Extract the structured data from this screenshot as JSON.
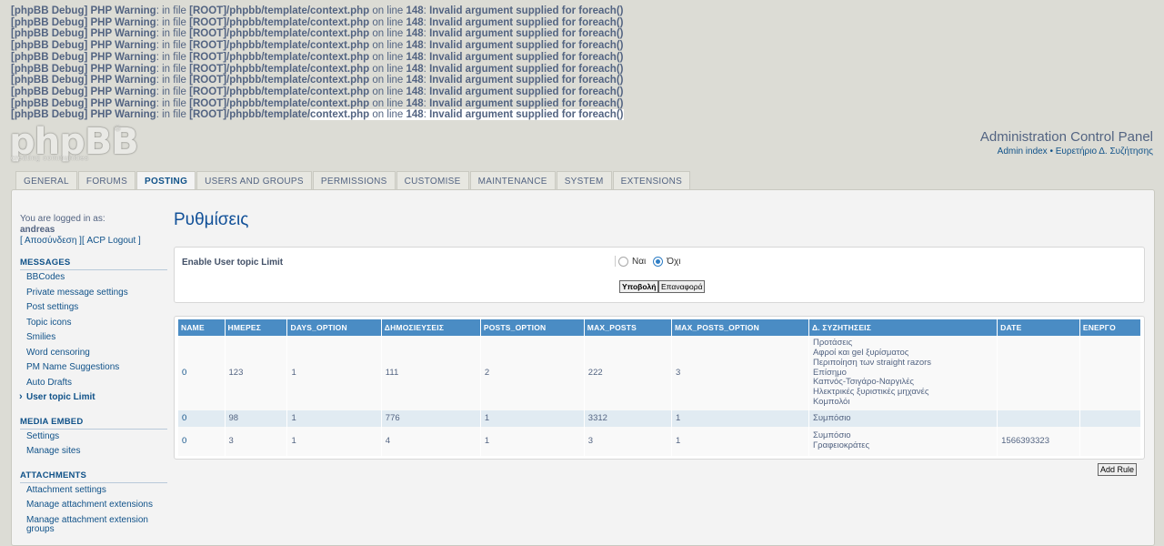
{
  "debug_lines": [
    {
      "prefix": "[phpBB Debug] PHP Warning",
      "t1": ": in file ",
      "file": "[ROOT]/phpbb/template/context.php",
      "t2": " on line ",
      "line": "148",
      "t3": ": ",
      "msg": "Invalid argument supplied for foreach()"
    },
    {
      "prefix": "[phpBB Debug] PHP Warning",
      "t1": ": in file ",
      "file": "[ROOT]/phpbb/template/context.php",
      "t2": " on line ",
      "line": "148",
      "t3": ": ",
      "msg": "Invalid argument supplied for foreach()"
    },
    {
      "prefix": "[phpBB Debug] PHP Warning",
      "t1": ": in file ",
      "file": "[ROOT]/phpbb/template/context.php",
      "t2": " on line ",
      "line": "148",
      "t3": ": ",
      "msg": "Invalid argument supplied for foreach()"
    },
    {
      "prefix": "[phpBB Debug] PHP Warning",
      "t1": ": in file ",
      "file": "[ROOT]/phpbb/template/context.php",
      "t2": " on line ",
      "line": "148",
      "t3": ": ",
      "msg": "Invalid argument supplied for foreach()"
    },
    {
      "prefix": "[phpBB Debug] PHP Warning",
      "t1": ": in file ",
      "file": "[ROOT]/phpbb/template/context.php",
      "t2": " on line ",
      "line": "148",
      "t3": ": ",
      "msg": "Invalid argument supplied for foreach()"
    },
    {
      "prefix": "[phpBB Debug] PHP Warning",
      "t1": ": in file ",
      "file": "[ROOT]/phpbb/template/context.php",
      "t2": " on line ",
      "line": "148",
      "t3": ": ",
      "msg": "Invalid argument supplied for foreach()"
    },
    {
      "prefix": "[phpBB Debug] PHP Warning",
      "t1": ": in file ",
      "file": "[ROOT]/phpbb/template/context.php",
      "t2": " on line ",
      "line": "148",
      "t3": ": ",
      "msg": "Invalid argument supplied for foreach()"
    },
    {
      "prefix": "[phpBB Debug] PHP Warning",
      "t1": ": in file ",
      "file": "[ROOT]/phpbb/template/context.php",
      "t2": " on line ",
      "line": "148",
      "t3": ": ",
      "msg": "Invalid argument supplied for foreach()"
    },
    {
      "prefix": "[phpBB Debug] PHP Warning",
      "t1": ": in file ",
      "file": "[ROOT]/phpbb/template/context.php",
      "t2": " on line ",
      "line": "148",
      "t3": ": ",
      "msg": "Invalid argument supplied for foreach()"
    },
    {
      "prefix": "[phpBB Debug] PHP Warning",
      "t1": ": in file ",
      "file": "[ROOT]/phpbb/template/",
      "file2": "context.php",
      "t2": " on line ",
      "line": "148",
      "t3": ": ",
      "msg": "Invalid argument supplied for foreach()"
    }
  ],
  "logo": {
    "text": "phpBB",
    "sub": "creating communities",
    "reg": "®"
  },
  "header": {
    "title": "Administration Control Panel",
    "link_admin": "Admin index",
    "sep": " • ",
    "link_board": "Ευρετήριο Δ. Συζήτησης"
  },
  "tabs": [
    "GENERAL",
    "FORUMS",
    "POSTING",
    "USERS AND GROUPS",
    "PERMISSIONS",
    "CUSTOMISE",
    "MAINTENANCE",
    "SYSTEM",
    "EXTENSIONS"
  ],
  "active_tab": "POSTING",
  "sidebar": {
    "logged_in_as": "You are logged in as:",
    "username": "andreas",
    "logout_links": "[ Αποσύνδεση ][ ACP Logout ]",
    "sections": [
      {
        "title": "MESSAGES",
        "items": [
          "BBCodes",
          "Private message settings",
          "Post settings",
          "Topic icons",
          "Smilies",
          "Word censoring",
          "PM Name Suggestions",
          "Auto Drafts",
          "User topic Limit"
        ]
      },
      {
        "title": "MEDIA EMBED",
        "items": [
          "Settings",
          "Manage sites"
        ]
      },
      {
        "title": "ATTACHMENTS",
        "items": [
          "Attachment settings",
          "Manage attachment extensions",
          "Manage attachment extension groups"
        ]
      }
    ],
    "active_item": "User topic Limit"
  },
  "main": {
    "title": "Ρυθμίσεις",
    "setting_label": "Enable User topic Limit",
    "radio_yes": "Ναι",
    "radio_no": "Όχι",
    "selected": "Όχι",
    "submit": "Υποβολή",
    "reset": "Επαναφορά",
    "add_rule": "Add Rule"
  },
  "table": {
    "headers": [
      "NAME",
      "ΗΜΕΡΕΣ",
      "DAYS_OPTION",
      "ΔΗΜΟΣΙΕΥΣΕΙΣ",
      "POSTS_OPTION",
      "MAX_POSTS",
      "MAX_POSTS_OPTION",
      "Δ. ΣΥΖΗΤΗΣΕΙΣ",
      "DATE",
      "ΕΝΕΡΓΟ"
    ],
    "rows": [
      {
        "name": "0",
        "days": "123",
        "days_option": "1",
        "posts": "111",
        "posts_option": "2",
        "max_posts": "222",
        "max_posts_option": "3",
        "forums": [
          "Προτάσεις",
          "Αφροί και gel ξυρίσματος",
          "Περιποίηση των straight razors",
          "Επίσημο",
          "Καπνός-Τσιγάρο-Ναργιλές",
          "Ηλεκτρικές ξυριστικές μηχανές",
          "Κομπολόι"
        ],
        "date": "",
        "active": ""
      },
      {
        "name": "0",
        "days": "98",
        "days_option": "1",
        "posts": "776",
        "posts_option": "1",
        "max_posts": "3312",
        "max_posts_option": "1",
        "forums": [
          "Συμπόσιο"
        ],
        "date": "",
        "active": ""
      },
      {
        "name": "0",
        "days": "3",
        "days_option": "1",
        "posts": "4",
        "posts_option": "1",
        "max_posts": "3",
        "max_posts_option": "1",
        "forums": [
          "Συμπόσιο",
          "Γραφειοκράτες"
        ],
        "date": "1566393323",
        "active": ""
      }
    ]
  }
}
